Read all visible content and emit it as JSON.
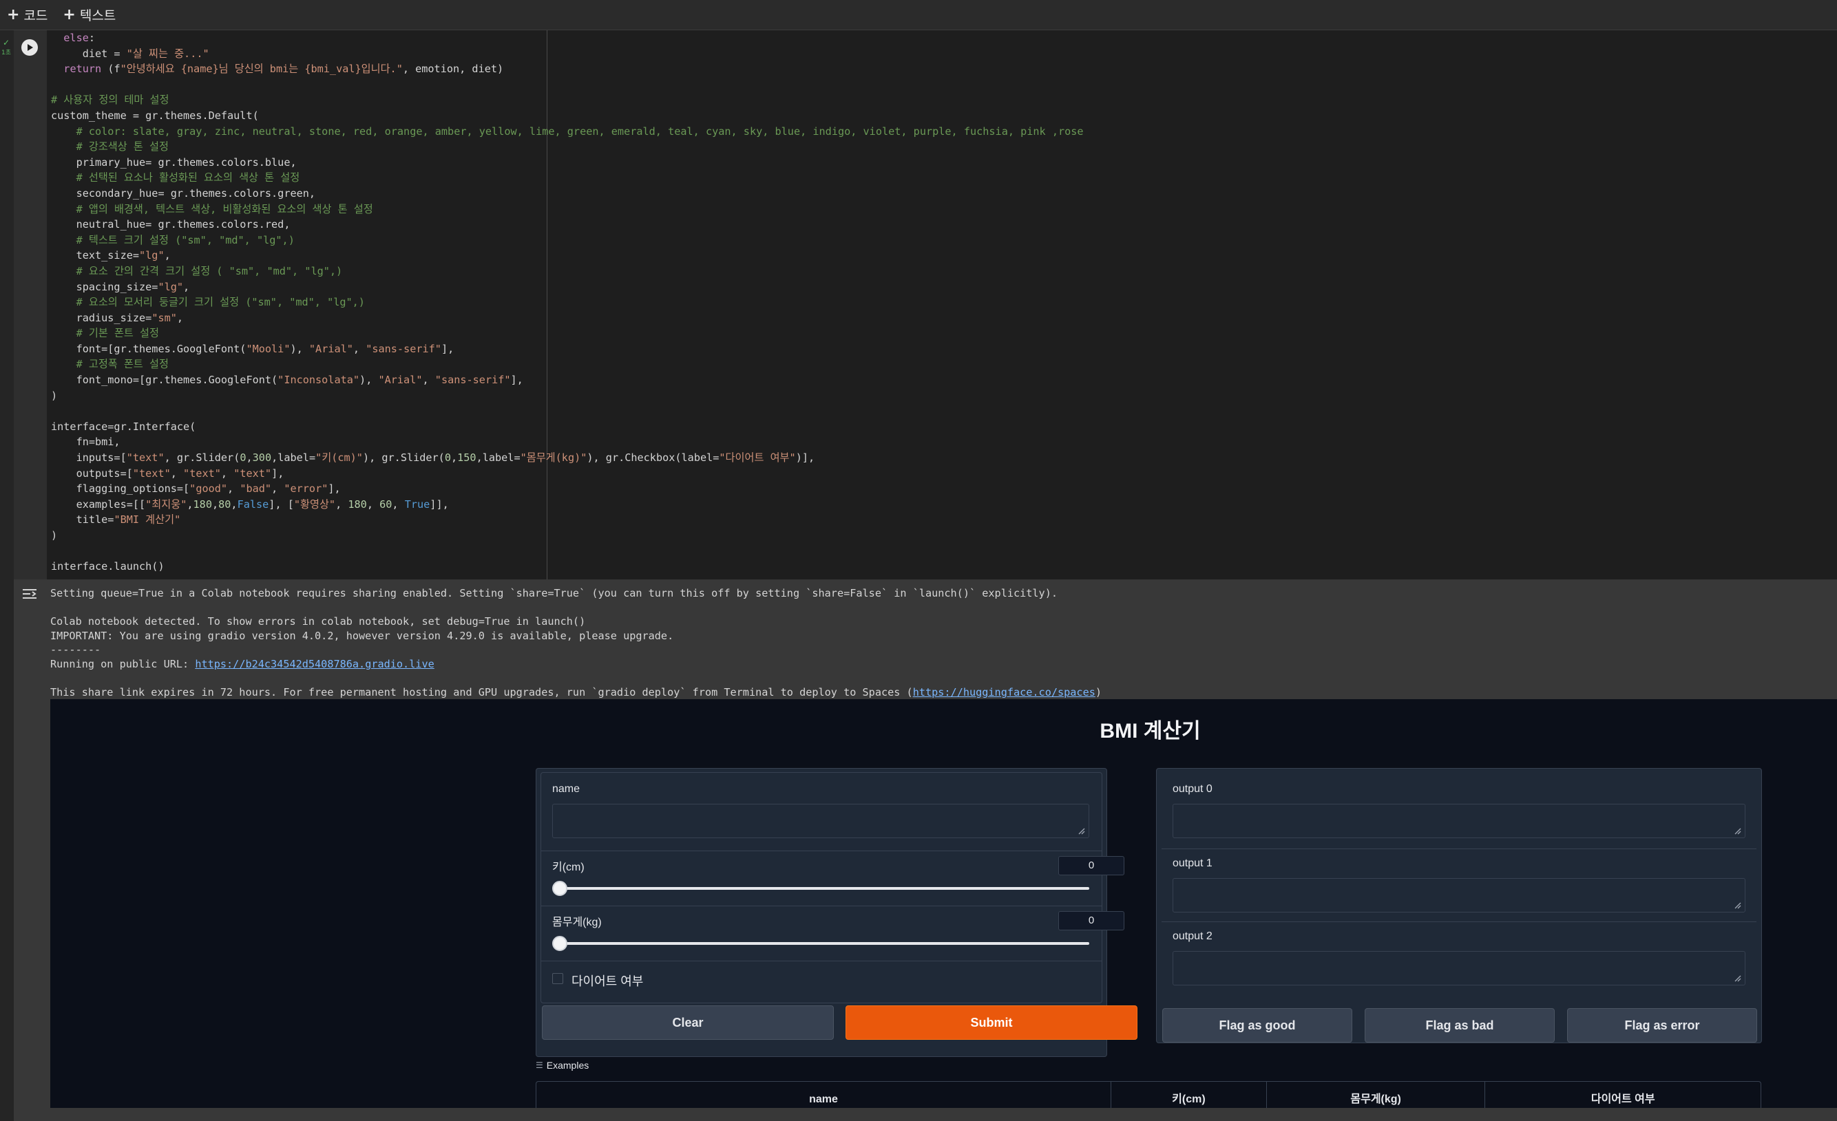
{
  "toolbar": {
    "add_code_label": "코드",
    "add_text_label": "텍스트"
  },
  "cell": {
    "exec_status": "✓\n1초"
  },
  "output": {
    "line1": "Setting queue=True in a Colab notebook requires sharing enabled. Setting `share=True` (you can turn this off by setting `share=False` in `launch()` explicitly).",
    "line2": "Colab notebook detected. To show errors in colab notebook, set debug=True in launch()",
    "line3": "IMPORTANT: You are using gradio version 4.0.2, however version 4.29.0 is available, please upgrade.",
    "line4": "--------",
    "running_prefix": "Running on public URL: ",
    "public_url": "https://b24c34542d5408786a.gradio.live",
    "expires_prefix": "This share link expires in 72 hours. For free permanent hosting and GPU upgrades, run `gradio deploy` from Terminal to deploy to Spaces (",
    "spaces_url": "https://huggingface.co/spaces",
    "expires_suffix": ")"
  },
  "app": {
    "title": "BMI 계산기",
    "inputs": {
      "name_label": "name",
      "height_label": "키(cm)",
      "height_value": "0",
      "height_fraction": 0,
      "weight_label": "몸무게(kg)",
      "weight_value": "0",
      "weight_fraction": 0,
      "diet_label": "다이어트 여부"
    },
    "buttons": {
      "clear": "Clear",
      "submit": "Submit",
      "flag_good": "Flag as good",
      "flag_bad": "Flag as bad",
      "flag_error": "Flag as error"
    },
    "outputs": {
      "output0_label": "output 0",
      "output1_label": "output 1",
      "output2_label": "output 2"
    },
    "examples": {
      "label": "Examples",
      "headers": [
        "name",
        "키(cm)",
        "몸무게(kg)",
        "다이어트 여부"
      ]
    }
  },
  "colors": {
    "accent_primary": "#ea580c",
    "app_background": "#0b0f19",
    "panel_background": "#1f2937",
    "link": "#7ab7ff"
  }
}
